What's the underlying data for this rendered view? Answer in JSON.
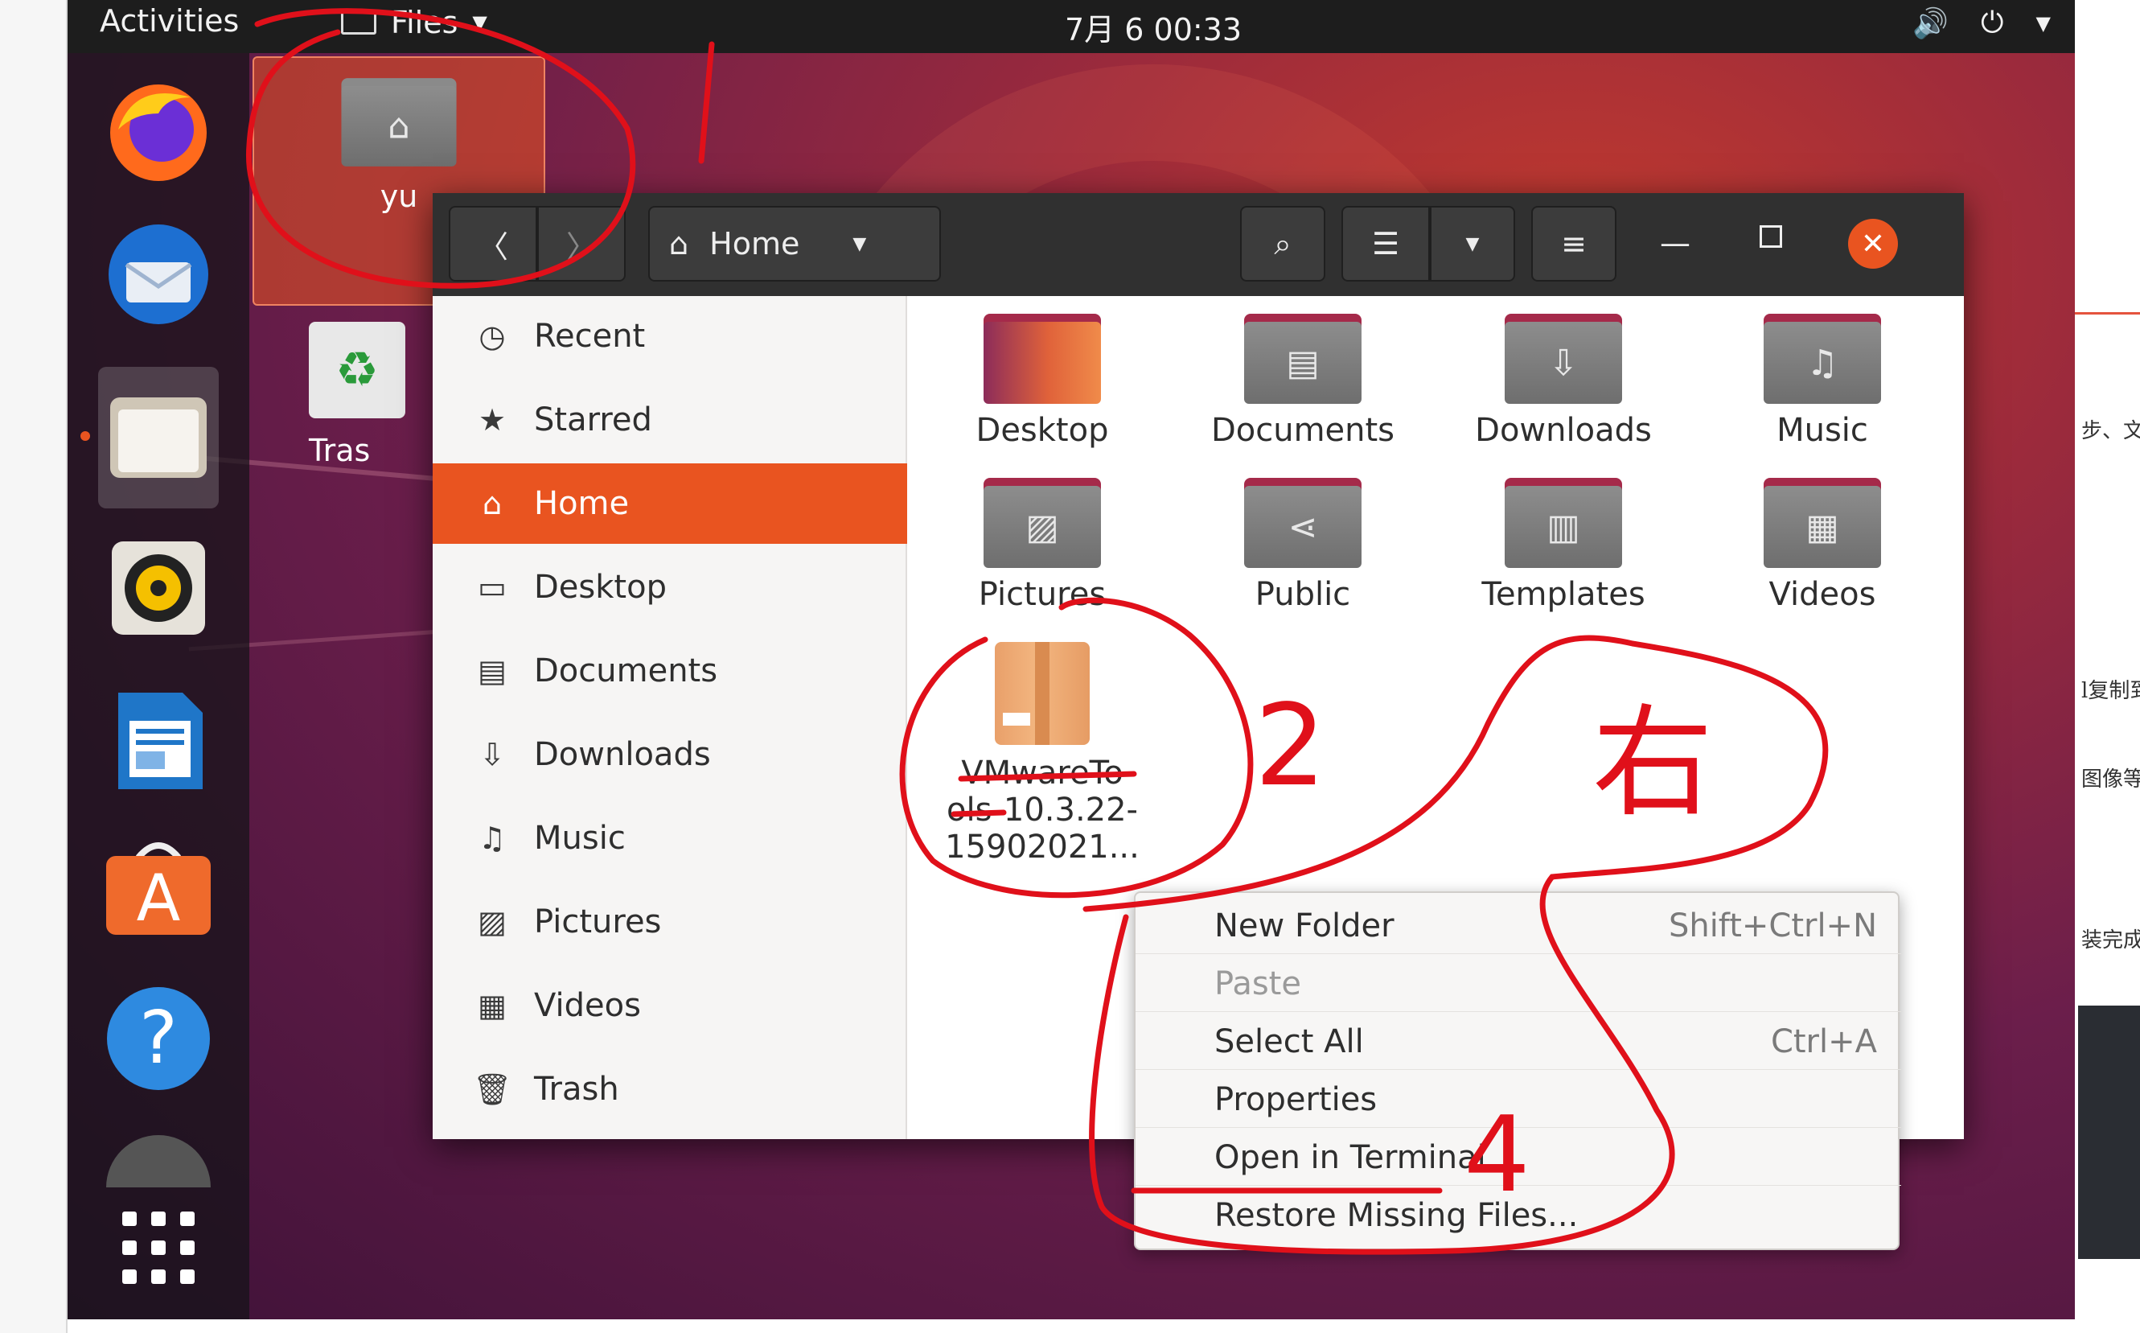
{
  "topbar": {
    "activities": "Activities",
    "app_name": "Files",
    "clock": "7月 6  00:33"
  },
  "dock": {
    "items": [
      "firefox-icon",
      "thunderbird-icon",
      "files-icon",
      "rhythmbox-icon",
      "libreoffice-writer-icon",
      "ubuntu-software-icon",
      "help-icon",
      "show-applications-icon"
    ]
  },
  "desktop": {
    "home_label": "yu",
    "trash_label": "Tras"
  },
  "window": {
    "location": "Home",
    "sidebar": [
      {
        "label": "Recent",
        "icon": "clock-icon"
      },
      {
        "label": "Starred",
        "icon": "star-icon"
      },
      {
        "label": "Home",
        "icon": "home-icon",
        "active": true
      },
      {
        "label": "Desktop",
        "icon": "desktop-icon"
      },
      {
        "label": "Documents",
        "icon": "documents-icon"
      },
      {
        "label": "Downloads",
        "icon": "downloads-icon"
      },
      {
        "label": "Music",
        "icon": "music-icon"
      },
      {
        "label": "Pictures",
        "icon": "pictures-icon"
      },
      {
        "label": "Videos",
        "icon": "videos-icon"
      },
      {
        "label": "Trash",
        "icon": "trash-icon"
      }
    ],
    "files": [
      {
        "name": "Desktop",
        "icon": "desktop-folder-icon"
      },
      {
        "name": "Documents",
        "icon": "documents-folder-icon"
      },
      {
        "name": "Downloads",
        "icon": "downloads-folder-icon"
      },
      {
        "name": "Music",
        "icon": "music-folder-icon"
      },
      {
        "name": "Pictures",
        "icon": "pictures-folder-icon"
      },
      {
        "name": "Public",
        "icon": "public-folder-icon"
      },
      {
        "name": "Templates",
        "icon": "templates-folder-icon"
      },
      {
        "name": "Videos",
        "icon": "videos-folder-icon"
      },
      {
        "name_line1": "VMwareTo",
        "name_line2": "ols-10.3.22-",
        "name_line3": "15902021...",
        "icon": "archive-package-icon"
      }
    ]
  },
  "context_menu": {
    "items": [
      {
        "label": "New Folder",
        "shortcut": "Shift+Ctrl+N"
      },
      {
        "label": "Paste",
        "shortcut": "",
        "disabled": true
      },
      {
        "label": "Select All",
        "shortcut": "Ctrl+A"
      },
      {
        "label": "Properties",
        "shortcut": ""
      },
      {
        "label": "Open in Terminal",
        "shortcut": ""
      },
      {
        "label": "Restore Missing Files...",
        "shortcut": ""
      }
    ]
  },
  "annotations": {
    "step1": "1",
    "step2": "2",
    "step3": "右",
    "step4": "4"
  },
  "right_page_fragments": [
    "步、文",
    "l复制到",
    "图像等口",
    "装完成"
  ],
  "colors": {
    "accent": "#e95420",
    "annotation": "#e0101a"
  }
}
